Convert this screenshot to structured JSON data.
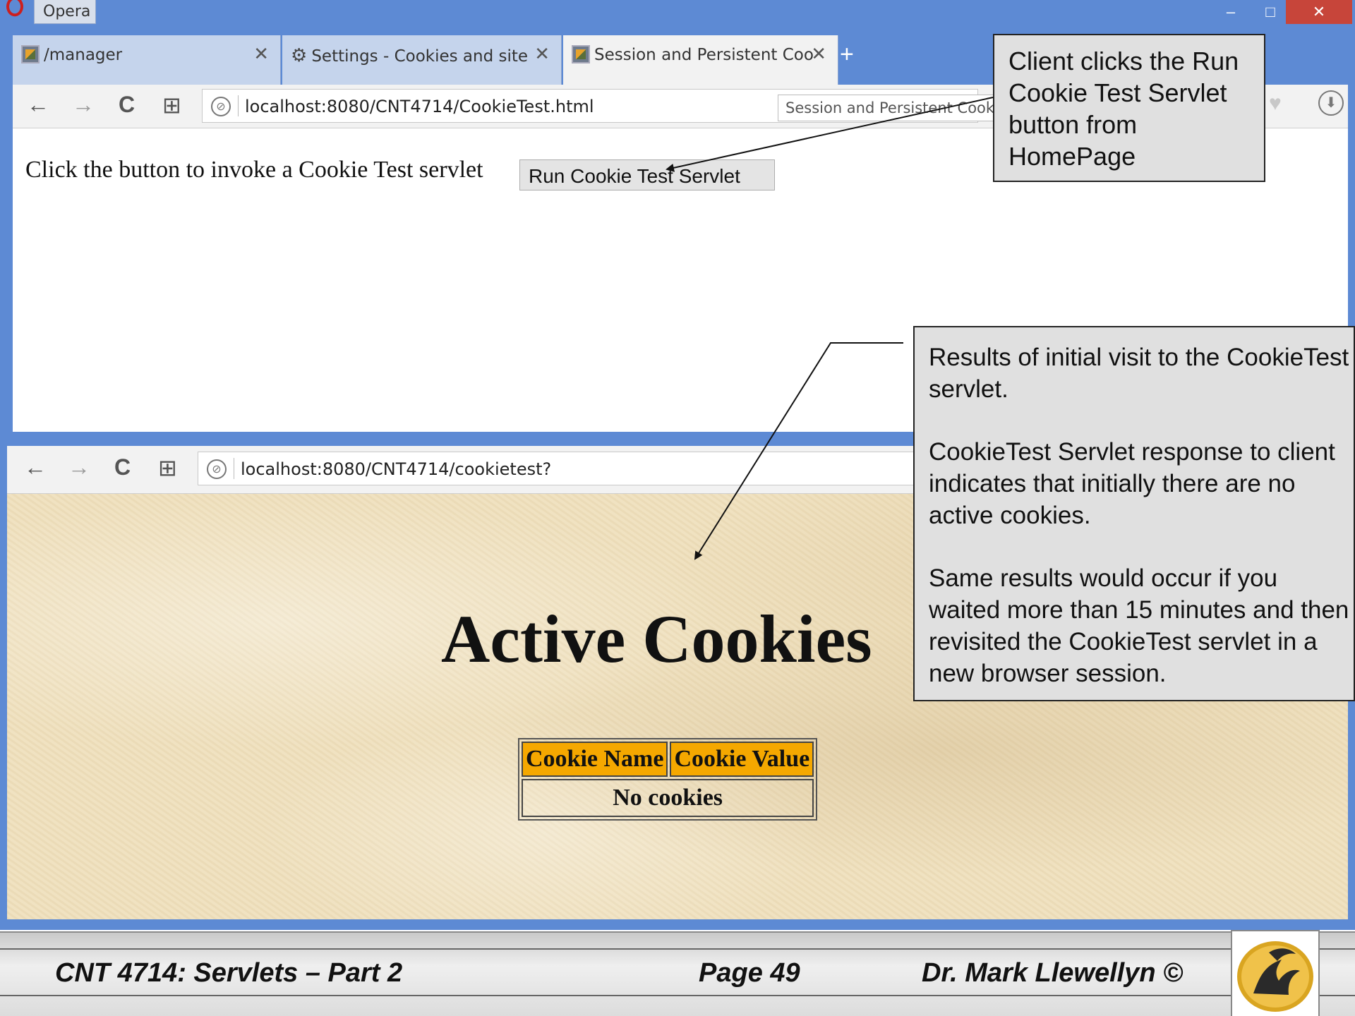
{
  "window1": {
    "app_title": "Opera",
    "titlebar_buttons": {
      "minimize": "–",
      "maximize": "□",
      "close": "✕"
    },
    "tabs": [
      {
        "label": "/manager",
        "close": "✕"
      },
      {
        "label": "Settings - Cookies and site",
        "close": "✕"
      },
      {
        "label": "Session and Persistent Coo",
        "close": "✕"
      }
    ],
    "new_tab": "+",
    "nav": {
      "back": "←",
      "forward": "→",
      "reload": "C",
      "speed_dial": "⊞"
    },
    "url": "localhost:8080/CNT4714/CookieTest.html",
    "search_value": "Session and Persistent Cookie",
    "content": {
      "prompt": "Click the button to invoke a Cookie Test servlet",
      "button_label": "Run Cookie Test Servlet"
    }
  },
  "window2": {
    "nav": {
      "back": "←",
      "forward": "→",
      "reload": "C",
      "speed_dial": "⊞"
    },
    "url": "localhost:8080/CNT4714/cookietest?",
    "content": {
      "heading": "Active Cookies",
      "table": {
        "headers": [
          "Cookie Name",
          "Cookie Value"
        ],
        "empty_row": "No cookies"
      }
    }
  },
  "callouts": {
    "callout1": "Client clicks the Run Cookie Test Servlet button from HomePage",
    "callout2": [
      "Results of initial visit to the CookieTest servlet.",
      "CookieTest Servlet response to client indicates that initially there are no active cookies.",
      "Same results would occur if you waited more than 15 minutes and then revisited the CookieTest servlet in a new browser session."
    ]
  },
  "footer": {
    "course": "CNT 4714: Servlets – Part 2",
    "page": "Page 49",
    "author": "Dr. Mark Llewellyn ©"
  },
  "colors": {
    "window_frame": "#5d8ad4",
    "table_header": "#f5a800",
    "callout_bg": "#e0e0e0",
    "page_bg": "#efe0bd"
  }
}
